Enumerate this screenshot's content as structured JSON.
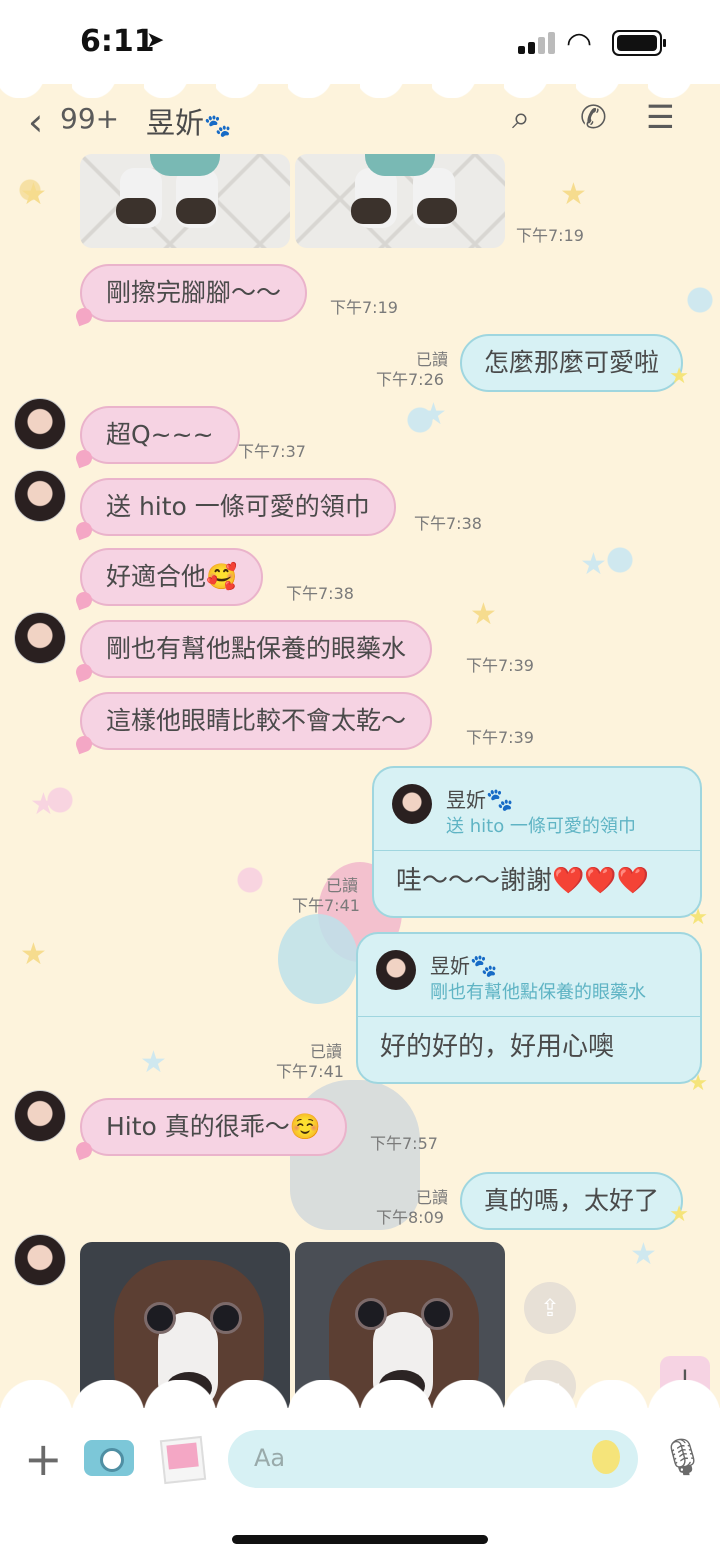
{
  "status": {
    "time": "6:11"
  },
  "header": {
    "back_count": "99+",
    "contact_name": "昱妡"
  },
  "messages": [
    {
      "text": "剛擦完腳腳～～",
      "time": "下午7:19"
    },
    {
      "text": "怎麼那麼可愛啦",
      "time": "下午7:26",
      "read": "已讀"
    },
    {
      "text": "超Q~~~",
      "time": "下午7:37"
    },
    {
      "text": "送 hito 一條可愛的領巾",
      "time": "下午7:38"
    },
    {
      "text": "好適合他🥰",
      "time": "下午7:38"
    },
    {
      "text": "剛也有幫他點保養的眼藥水",
      "time": "下午7:39"
    },
    {
      "text": "這樣他眼睛比較不會太乾～",
      "time": "下午7:39"
    },
    {
      "reply_name": "昱妡",
      "reply_quote": "送 hito 一條可愛的領巾",
      "text": "哇～～～謝謝❤️❤️❤️",
      "time": "下午7:41",
      "read": "已讀"
    },
    {
      "reply_name": "昱妡",
      "reply_quote": "剛也有幫他點保養的眼藥水",
      "text": "好的好的，好用心噢",
      "time": "下午7:41",
      "read": "已讀"
    },
    {
      "text": "Hito 真的很乖～☺️",
      "time": "下午7:57"
    },
    {
      "text": "真的嗎，太好了",
      "time": "下午8:09",
      "read": "已讀"
    }
  ],
  "photo_time": "下午7:19",
  "input": {
    "placeholder": "Aa"
  },
  "icons": [
    "back-icon",
    "paw-icon",
    "search-icon",
    "phone-icon",
    "menu-icon",
    "share-icon",
    "screenshot-icon",
    "scroll-down-icon",
    "plus-icon",
    "camera-icon",
    "photo-icon",
    "mic-icon"
  ]
}
